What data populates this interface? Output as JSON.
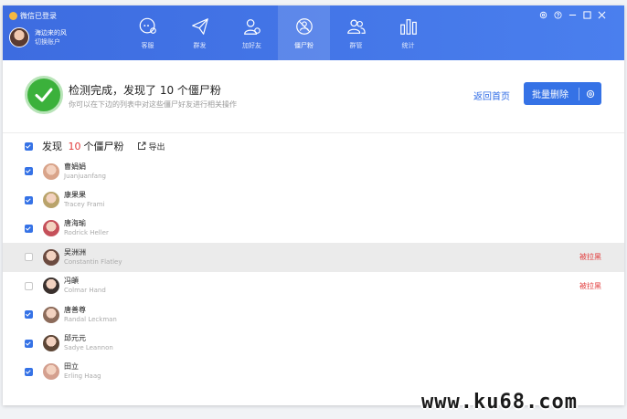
{
  "app": {
    "title": "微信已登录"
  },
  "user": {
    "name": "海边来的风",
    "switch_label": "切换账户"
  },
  "tabs": [
    {
      "label": "客服",
      "icon": "chat-bubble-icon"
    },
    {
      "label": "群发",
      "icon": "paper-plane-icon"
    },
    {
      "label": "加好友",
      "icon": "add-friend-icon"
    },
    {
      "label": "僵尸粉",
      "icon": "zombie-fan-icon",
      "active": true
    },
    {
      "label": "群管",
      "icon": "group-icon"
    },
    {
      "label": "统计",
      "icon": "bar-chart-icon"
    }
  ],
  "window_controls": [
    "settings-icon",
    "help-icon",
    "minimize-icon",
    "maximize-icon",
    "close-icon"
  ],
  "banner": {
    "title": "检测完成，发现了 10 个僵尸粉",
    "subtitle": "你可以在下边的列表中对这些僵尸好友进行相关操作",
    "back_label": "返回首页",
    "batch_label": "批量删除"
  },
  "list": {
    "prefix": "发现",
    "count": "10",
    "suffix": "个僵尸粉",
    "export_label": "导出",
    "rows": [
      {
        "nick": "曹娟娟",
        "remark": "Juanjuanfang",
        "checked": true,
        "status": "",
        "avatar_color": "#d9a48a"
      },
      {
        "nick": "康果果",
        "remark": "Tracey Frami",
        "checked": true,
        "status": "",
        "avatar_color": "#b9a36b"
      },
      {
        "nick": "唐海瑜",
        "remark": "Rodrick Heller",
        "checked": true,
        "status": "",
        "avatar_color": "#c5505a"
      },
      {
        "nick": "吴洲洲",
        "remark": "Constantin Flatley",
        "checked": false,
        "status": "被拉黑",
        "avatar_color": "#6b4a3f"
      },
      {
        "nick": "冯頔",
        "remark": "Colmar Hand",
        "checked": false,
        "status": "被拉黑",
        "avatar_color": "#3a302d"
      },
      {
        "nick": "唐善尊",
        "remark": "Randal Leckman",
        "checked": true,
        "status": "",
        "avatar_color": "#8c6b5a"
      },
      {
        "nick": "邱元元",
        "remark": "Sadye Leannon",
        "checked": true,
        "status": "",
        "avatar_color": "#5d4636"
      },
      {
        "nick": "田立",
        "remark": "Erling Haag",
        "checked": true,
        "status": "",
        "avatar_color": "#d4a08f"
      }
    ]
  },
  "watermark": "www.ku68.com"
}
